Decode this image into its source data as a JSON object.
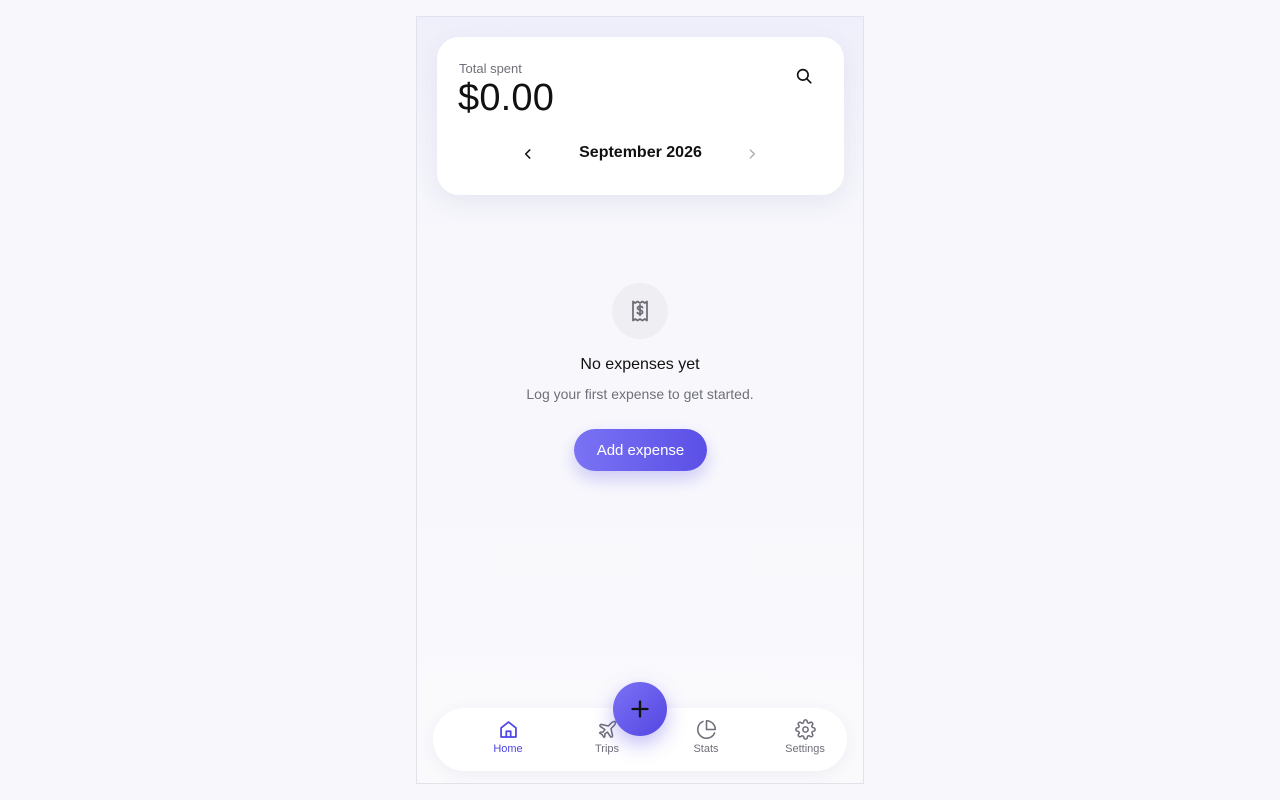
{
  "header": {
    "total_label": "Total spent",
    "total_amount": "$0.00",
    "month": "September 2026"
  },
  "empty_state": {
    "title": "No expenses yet",
    "subtitle": "Log your first expense to get started.",
    "button_label": "Add expense"
  },
  "nav": {
    "items": [
      {
        "label": "Home",
        "icon": "home-icon",
        "active": true
      },
      {
        "label": "Trips",
        "icon": "plane-icon",
        "active": false
      },
      {
        "label": "Stats",
        "icon": "pie-chart-icon",
        "active": false
      },
      {
        "label": "Settings",
        "icon": "gear-icon",
        "active": false
      }
    ]
  },
  "colors": {
    "accent": "#5b4fe6",
    "accent_light": "#7a73f4",
    "muted_text": "#6f6f7a",
    "background": "#f8f8fc"
  }
}
